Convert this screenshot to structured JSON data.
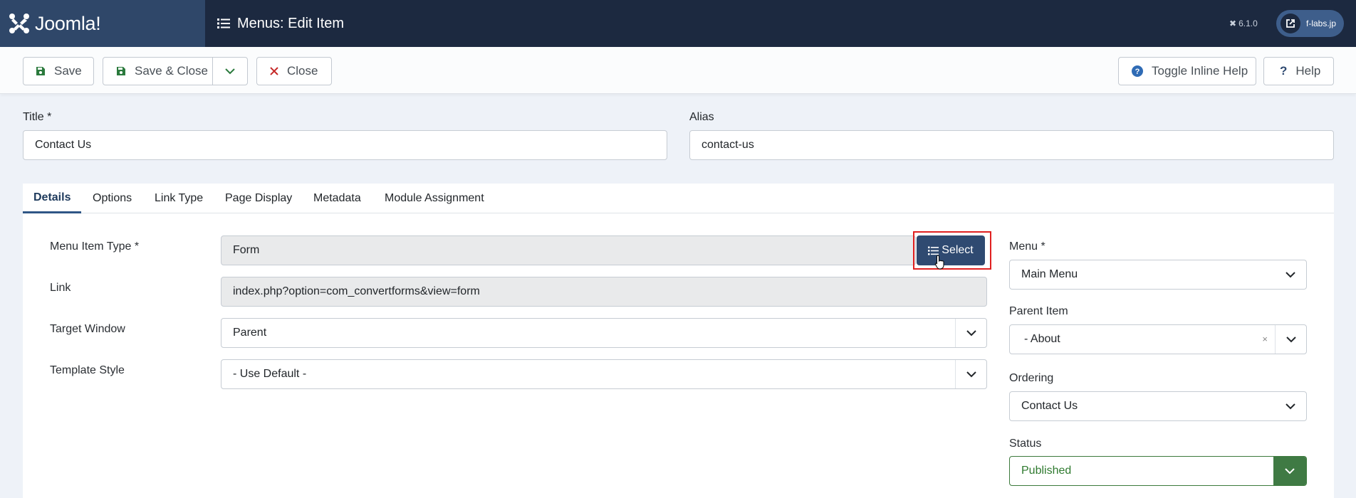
{
  "header": {
    "logo_text": "Joomla!",
    "page_title": "Menus: Edit Item",
    "version": "6.1.0",
    "site_link": "f-labs.jp"
  },
  "toolbar": {
    "save": "Save",
    "save_close": "Save & Close",
    "close": "Close",
    "toggle_help": "Toggle Inline Help",
    "help": "Help"
  },
  "form": {
    "title_label": "Title *",
    "title_value": "Contact Us",
    "alias_label": "Alias",
    "alias_value": "contact-us"
  },
  "tabs": [
    "Details",
    "Options",
    "Link Type",
    "Page Display",
    "Metadata",
    "Module Assignment"
  ],
  "details": {
    "menu_item_type_label": "Menu Item Type *",
    "menu_item_type_value": "Form",
    "select_button": "Select",
    "link_label": "Link",
    "link_value": "index.php?option=com_convertforms&view=form",
    "target_window_label": "Target Window",
    "target_window_value": "Parent",
    "template_style_label": "Template Style",
    "template_style_value": "- Use Default -"
  },
  "sidebar": {
    "menu_label": "Menu *",
    "menu_value": "Main Menu",
    "parent_label": "Parent Item",
    "parent_value": "- About",
    "parent_clear": "×",
    "ordering_label": "Ordering",
    "ordering_value": "Contact Us",
    "status_label": "Status",
    "status_value": "Published"
  },
  "colors": {
    "header_bg": "#1c2940",
    "logo_bg": "#2f4769",
    "select_button_bg": "#2f4a71",
    "status_green": "#3f7a44",
    "highlight_red": "#e02020"
  }
}
